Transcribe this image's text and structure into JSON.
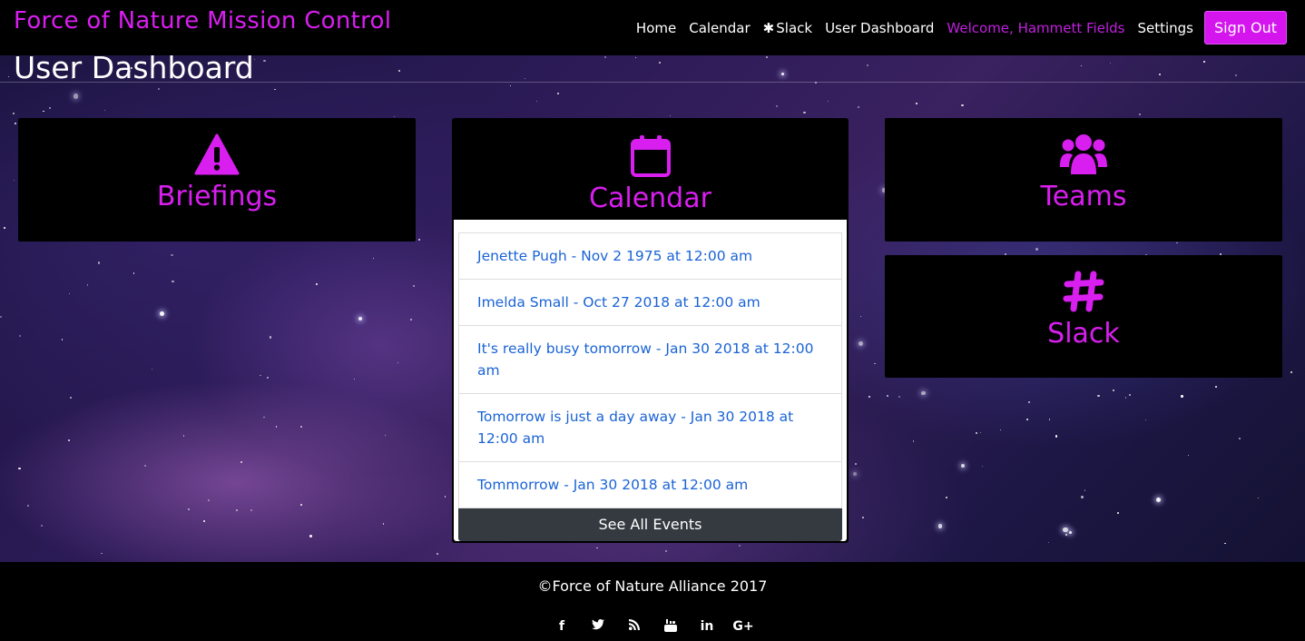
{
  "navbar": {
    "brand": "Force of Nature Mission Control",
    "links": {
      "home": "Home",
      "calendar": "Calendar",
      "slack": "Slack",
      "user_dashboard": "User Dashboard",
      "welcome": "Welcome, Hammett Fields",
      "settings": "Settings"
    },
    "sign_out": "Sign Out"
  },
  "page": {
    "title": "User Dashboard"
  },
  "cards": {
    "briefings": {
      "title": "Briefings",
      "icon": "warning-icon"
    },
    "calendar": {
      "title": "Calendar",
      "icon": "calendar-icon"
    },
    "teams": {
      "title": "Teams",
      "icon": "users-icon"
    },
    "slack": {
      "title": "Slack",
      "icon": "slack-hash-icon"
    }
  },
  "events": [
    "Jenette Pugh - Nov 2 1975 at 12:00 am",
    "Imelda Small - Oct 27 2018 at 12:00 am",
    "It's really busy tomorrow - Jan 30 2018 at 12:00 am",
    "Tomorrow is just a day away - Jan 30 2018 at 12:00 am",
    "Tommorrow - Jan 30 2018 at 12:00 am"
  ],
  "see_all_events": "See All Events",
  "footer": {
    "copyright": "©Force of Nature Alliance 2017",
    "social_icons": [
      "facebook-icon",
      "twitter-icon",
      "rss-icon",
      "youtube-icon",
      "linkedin-icon",
      "google-plus-icon"
    ]
  },
  "colors": {
    "accent": "#d91ef0",
    "link": "#1a63d6",
    "button_dark": "#343a40"
  }
}
